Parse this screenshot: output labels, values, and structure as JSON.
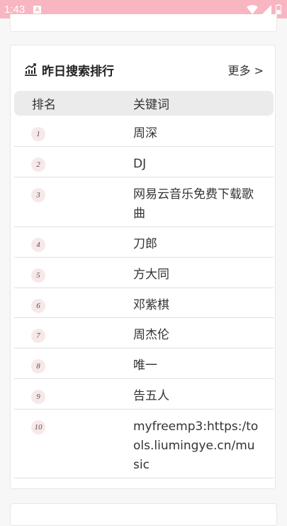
{
  "status_bar": {
    "time": "1:43",
    "notification_icon": "a-icon",
    "wifi_icon": "wifi-icon",
    "signal_icon": "signal-icon",
    "battery_icon": "battery-icon"
  },
  "ranking_card": {
    "icon": "chart-icon",
    "title": "昨日搜索排行",
    "more_label": "更多 >",
    "columns": {
      "rank": "排名",
      "keyword": "关键词"
    },
    "rows": [
      {
        "rank": "1",
        "keyword": "周深"
      },
      {
        "rank": "2",
        "keyword": "DJ"
      },
      {
        "rank": "3",
        "keyword": "网易云音乐免费下载歌曲"
      },
      {
        "rank": "4",
        "keyword": "刀郎"
      },
      {
        "rank": "5",
        "keyword": "方大同"
      },
      {
        "rank": "6",
        "keyword": "邓紫棋"
      },
      {
        "rank": "7",
        "keyword": "周杰伦"
      },
      {
        "rank": "8",
        "keyword": "唯一"
      },
      {
        "rank": "9",
        "keyword": "告五人"
      },
      {
        "rank": "10",
        "keyword": "myfreemp3:https:/tools.liumingye.cn/music"
      }
    ]
  },
  "colors": {
    "status_bar": "#f7b6c2",
    "badge_bg": "#f7e8e9",
    "header_bg": "#ebebeb"
  }
}
